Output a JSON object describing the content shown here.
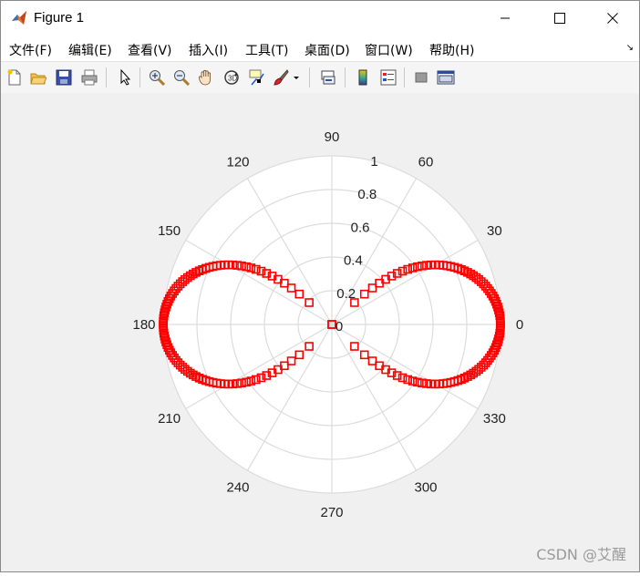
{
  "window": {
    "title": "Figure 1",
    "controls": {
      "minimize": "minimize",
      "maximize": "maximize",
      "close": "close"
    }
  },
  "menubar": {
    "items": [
      {
        "label": "文件(F)"
      },
      {
        "label": "编辑(E)"
      },
      {
        "label": "查看(V)"
      },
      {
        "label": "插入(I)"
      },
      {
        "label": "工具(T)"
      },
      {
        "label": "桌面(D)"
      },
      {
        "label": "窗口(W)"
      },
      {
        "label": "帮助(H)"
      }
    ],
    "dock_arrow": "↘"
  },
  "toolbar": {
    "icons": [
      "new-figure-icon",
      "open-file-icon",
      "save-icon",
      "print-icon",
      "select-arrow-icon",
      "zoom-in-icon",
      "zoom-out-icon",
      "pan-hand-icon",
      "rotate-3d-icon",
      "data-cursor-icon",
      "brush-icon",
      "link-plot-icon",
      "colorbar-icon",
      "legend-icon",
      "hide-plot-tools-icon",
      "show-plot-tools-icon"
    ]
  },
  "chart_data": {
    "type": "polar",
    "theta_tick_labels": [
      "0",
      "30",
      "60",
      "90",
      "120",
      "150",
      "180",
      "210",
      "240",
      "270",
      "300",
      "330"
    ],
    "r_tick_labels": [
      "0",
      "0.2",
      "0.4",
      "0.6",
      "0.8",
      "1"
    ],
    "rlim": [
      0,
      1
    ],
    "grid": true,
    "series": [
      {
        "equation": "r^2 = cos(2θ)",
        "marker": "square",
        "color": "#ff0000",
        "theta_range_deg": [
          0,
          360
        ]
      }
    ]
  },
  "watermark": "CSDN @艾醒"
}
